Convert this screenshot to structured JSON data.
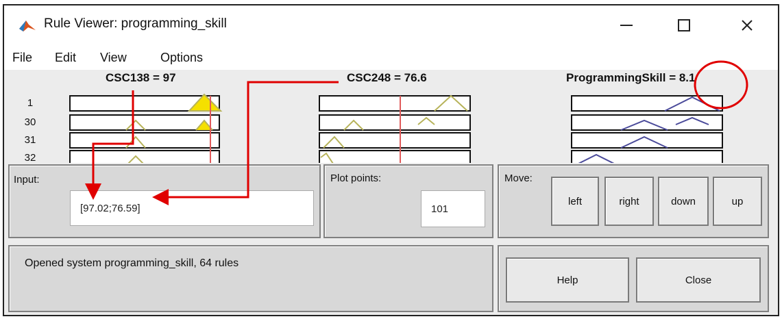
{
  "window": {
    "title": "Rule Viewer: programming_skill",
    "minimize_glyph": "—",
    "maximize_glyph": "☐",
    "close_glyph": "✕"
  },
  "menu": {
    "items": [
      "File",
      "Edit",
      "View",
      "Options"
    ]
  },
  "plot": {
    "inputs": [
      {
        "title": "CSC138 = 97"
      },
      {
        "title": "CSC248 = 76.6"
      }
    ],
    "output": {
      "title": "ProgrammingSkill = 8.1"
    },
    "rule_numbers": [
      "1",
      "30",
      "31",
      "32"
    ],
    "colors": {
      "input_mf": "#b7b35a",
      "output_mf": "#4a4a9a",
      "marker": "#e05a5a",
      "fill": "#f5e000",
      "annotation": "#e00000"
    }
  },
  "input_panel": {
    "label": "Input:",
    "value": "[97.02;76.59]"
  },
  "plot_points": {
    "label": "Plot points:",
    "value": "101"
  },
  "move": {
    "label": "Move:",
    "buttons": [
      "left",
      "right",
      "down",
      "up"
    ]
  },
  "status": {
    "text": "Opened system programming_skill, 64 rules"
  },
  "actions": {
    "help": "Help",
    "close": "Close"
  }
}
